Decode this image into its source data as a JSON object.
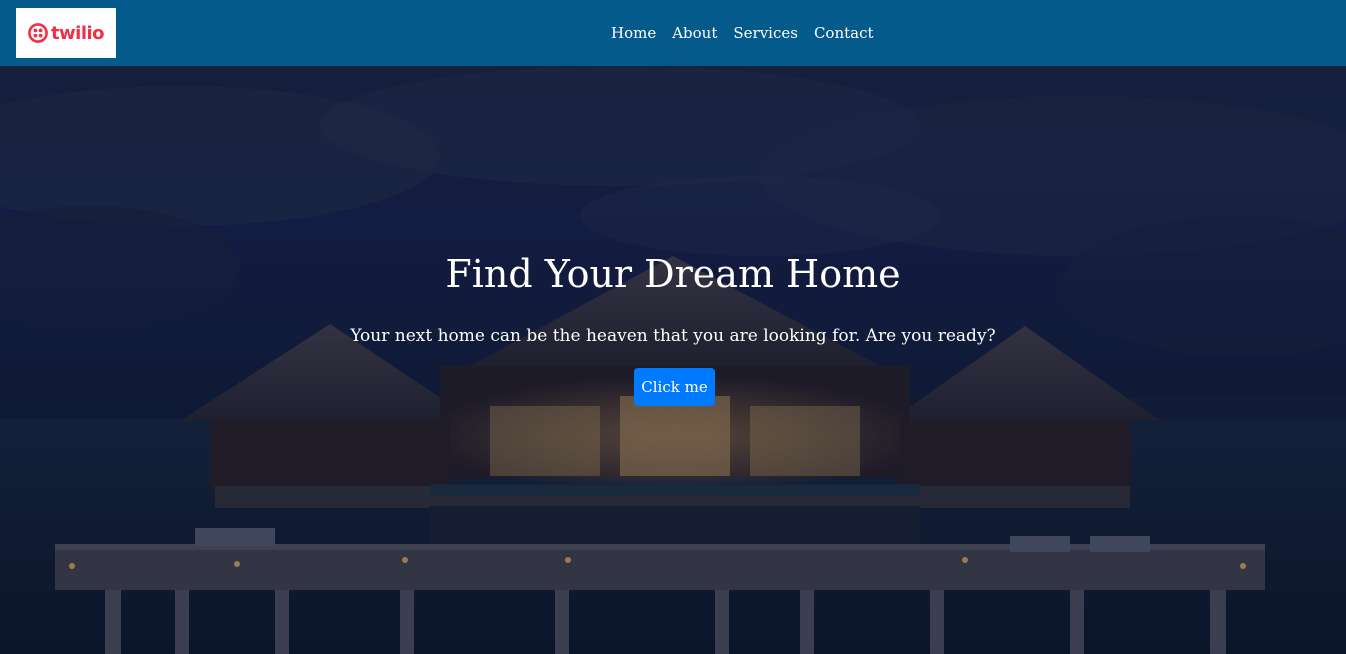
{
  "brand": {
    "logo_text": "twilio",
    "logo_color": "#f22f46"
  },
  "nav": {
    "background": "#055a8c",
    "items": [
      {
        "label": "Home"
      },
      {
        "label": "About"
      },
      {
        "label": "Services"
      },
      {
        "label": "Contact"
      }
    ]
  },
  "hero": {
    "title": "Find Your Dream Home",
    "subtitle": "Your next home can be the heaven that you are looking for. Are you ready?",
    "cta_label": "Click me",
    "cta_color": "#007bff",
    "background_icon": "overwater-villa-night-image"
  }
}
